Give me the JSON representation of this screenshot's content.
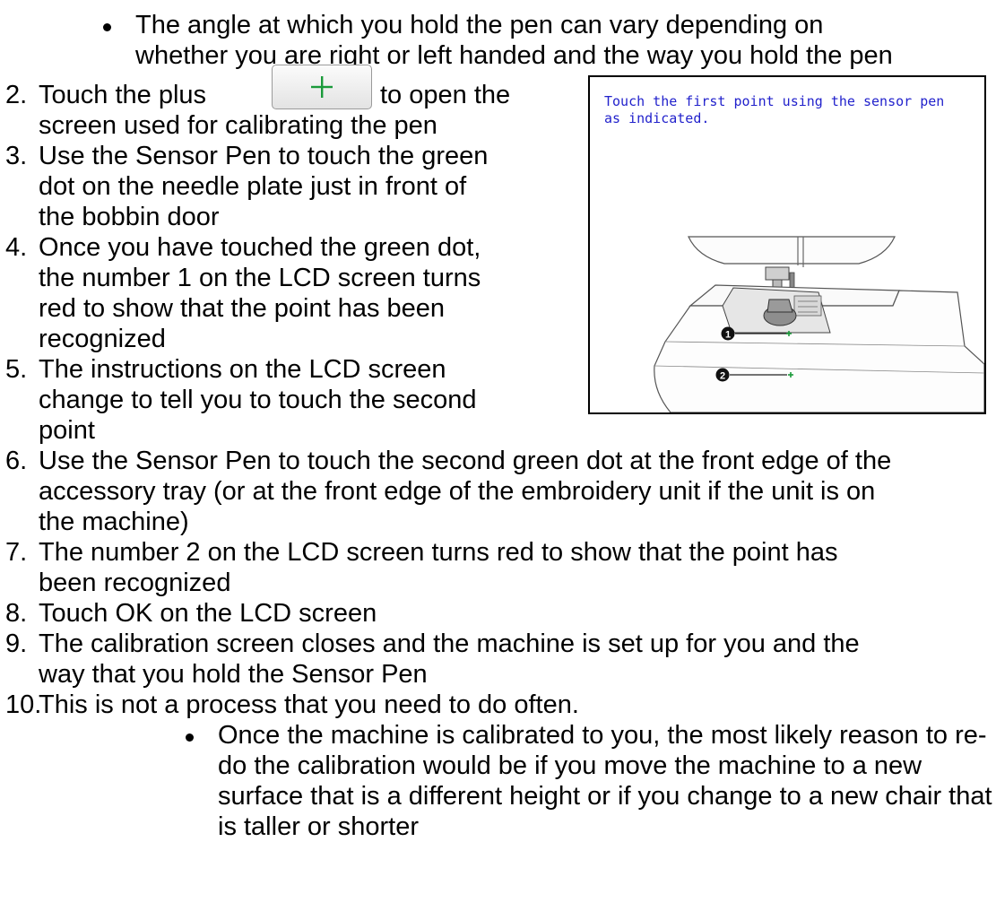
{
  "bullet_top": {
    "line1": "The angle at which you hold the pen can vary depending on",
    "line2": "whether you are right or left handed and the way you hold the pen"
  },
  "steps": {
    "s2": {
      "num": "2.",
      "a": "Touch the plus",
      "b": "to open the",
      "c": "screen used for calibrating the pen"
    },
    "s3": {
      "num": "3.",
      "l1": "Use the Sensor Pen to touch the green",
      "l2": "dot on the needle plate just in front of",
      "l3": "the bobbin door"
    },
    "s4": {
      "num": "4.",
      "l1": "Once you have touched the green dot,",
      "l2": "the number 1 on the LCD screen turns",
      "l3": "red to show that the point has been",
      "l4": "recognized"
    },
    "s5": {
      "num": "5.",
      "l1": "The instructions on the LCD screen",
      "l2": "change to tell you to touch the second",
      "l3": "point"
    },
    "s6": {
      "num": "6.",
      "l1": "Use the Sensor Pen to touch the second green dot at the front edge of the",
      "l2": "accessory tray (or at the front edge of the embroidery unit if the unit is on",
      "l3": "the machine)"
    },
    "s7": {
      "num": "7.",
      "l1": "The number 2 on the LCD screen turns red to show that the point has",
      "l2": "been recognized"
    },
    "s8": {
      "num": "8.",
      "l1": "Touch OK on the LCD screen"
    },
    "s9": {
      "num": "9.",
      "l1": "The calibration screen closes and the machine is set up for you and the",
      "l2": "way that you hold the Sensor Pen"
    },
    "s10": {
      "num": "10.",
      "l1": "This is not a process that you need to do often."
    }
  },
  "bullet_bottom": {
    "l1": "Once the machine is calibrated to you, the most likely reason to re-",
    "l2": "do the calibration would be if you move the machine to a new",
    "l3": "surface that is a different height or if you change to a new chair that",
    "l4": "is taller or shorter"
  },
  "plus_button": {
    "icon": "plus-icon",
    "color": "#1a9a3a"
  },
  "lcd": {
    "message": "Touch the first point using the sensor pen as indicated.",
    "text_color": "#2222cc",
    "point_color": "#1a9a3a",
    "callouts": [
      "1",
      "2"
    ]
  }
}
